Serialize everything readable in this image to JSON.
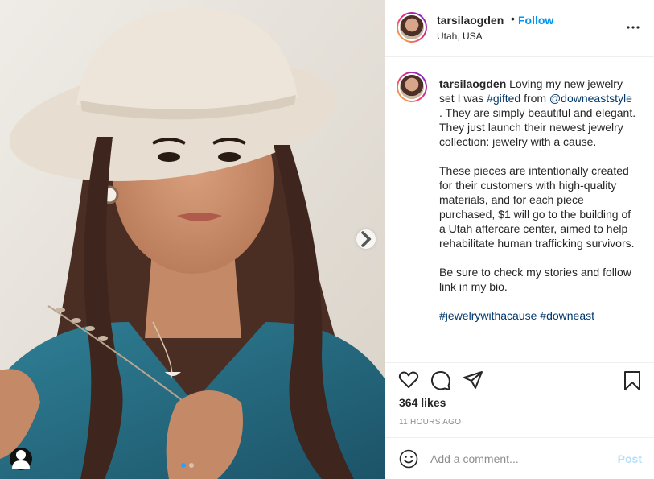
{
  "post": {
    "username": "tarsilaogden",
    "follow_label": "Follow",
    "bullet": "•",
    "location": "Utah, USA",
    "more_icon": "more-options-icon"
  },
  "caption": {
    "username": "tarsilaogden",
    "text_1": " Loving my new jewelry set I was ",
    "hashtag_1": "#gifted",
    "text_2": " from ",
    "mention_1": "@downeaststyle",
    "text_3": " . They are simply beautiful and elegant. They just launch their newest jewelry collection: jewelry with a cause.\n\nThese pieces are intentionally created for their customers with high-quality materials, and for each piece purchased, $1 will go to the building of a Utah aftercare center, aimed to help rehabilitate human trafficking survivors.\n\nBe sure to check my stories and follow link in my bio.\n\n",
    "hashtag_2": "#jewelrywithacause",
    "text_4": " ",
    "hashtag_3": "#downeast"
  },
  "actions": {
    "like_icon": "heart-icon",
    "comment_icon": "comment-icon",
    "share_icon": "share-icon",
    "save_icon": "bookmark-icon"
  },
  "likes_label": "364 likes",
  "timestamp": "11 HOURS AGO",
  "comment": {
    "placeholder": "Add a comment...",
    "post_label": "Post",
    "emoji_icon": "emoji-icon"
  },
  "carousel": {
    "total": 2,
    "active_index": 0
  },
  "colors": {
    "follow": "#0095f6",
    "link": "#00376b",
    "post_disabled": "#b2dffc",
    "muted": "#8e8e8e"
  }
}
